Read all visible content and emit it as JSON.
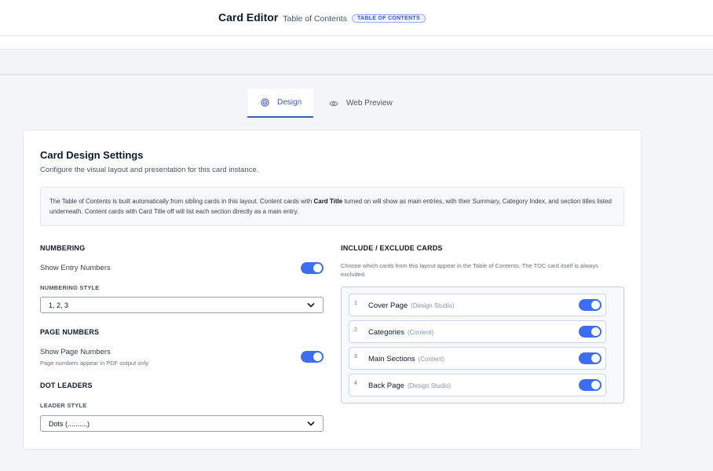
{
  "header": {
    "title": "Card Editor",
    "subtitle": "Table of Contents",
    "badge": "TABLE OF CONTENTS"
  },
  "tabs": [
    {
      "label": "Design",
      "icon": "target-icon",
      "active": true
    },
    {
      "label": "Web Preview",
      "icon": "eye-icon",
      "active": false
    }
  ],
  "card": {
    "title": "Card Design Settings",
    "description": "Configure the visual layout and presentation for this card instance.",
    "info": {
      "part1": "The Table of Contents is built automatically from sibling cards in this layout. Content cards with ",
      "bold": "Card Title",
      "part2": " turned on will show as main entries, with their Summary, Category Index, and section titles listed underneath. Content cards with Card Title off will list each section directly as a main entry."
    }
  },
  "numbering": {
    "heading": "NUMBERING",
    "show_label": "Show Entry Numbers",
    "show_enabled": true,
    "style_label": "NUMBERING STYLE",
    "style_value": "1, 2, 3"
  },
  "page_numbers": {
    "heading": "PAGE NUMBERS",
    "show_label": "Show Page Numbers",
    "hint": "Page numbers appear in PDF output only",
    "show_enabled": true
  },
  "dot_leaders": {
    "heading": "DOT LEADERS",
    "style_label": "LEADER STYLE",
    "style_value": "Dots (..........)"
  },
  "include": {
    "heading": "INCLUDE / EXCLUDE CARDS",
    "description": "Choose which cards from this layout appear in the Table of Contents. The TOC card itself is always excluded.",
    "items": [
      {
        "num": "1",
        "name": "Cover Page",
        "tag": "(Design Studio)",
        "enabled": true
      },
      {
        "num": "2",
        "name": "Categories",
        "tag": "(Content)",
        "enabled": true
      },
      {
        "num": "3",
        "name": "Main Sections",
        "tag": "(Content)",
        "enabled": true
      },
      {
        "num": "4",
        "name": "Back Page",
        "tag": "(Design Studio)",
        "enabled": true
      }
    ]
  },
  "colors": {
    "accent": "#3b5bc7",
    "toggle_on": "#3b6ff0"
  }
}
